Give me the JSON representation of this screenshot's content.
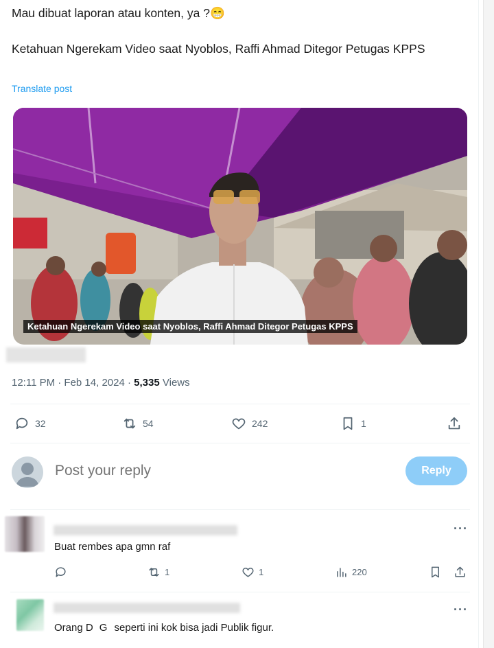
{
  "post": {
    "text_line1": "Mau dibuat laporan atau konten, ya ?😁",
    "text_line2": "Ketahuan Ngerekam Video saat Nyoblos, Raffi Ahmad Ditegor Petugas KPPS",
    "translate_label": "Translate post",
    "video_caption": "Ketahuan Ngerekam Video saat Nyoblos, Raffi Ahmad Ditegor Petugas KPPS",
    "timestamp": "12:11 PM · Feb 14, 2024",
    "separator": " · ",
    "views_count": "5,335",
    "views_label": "Views"
  },
  "actions": {
    "replies": "32",
    "reposts": "54",
    "likes": "242",
    "bookmarks": "1"
  },
  "reply_box": {
    "placeholder": "Post your reply",
    "button_label": "Reply"
  },
  "comments": [
    {
      "text": "Buat rembes apa gmn raf",
      "replies": "",
      "reposts": "1",
      "likes": "1",
      "views": "220",
      "more": "···"
    },
    {
      "text": "Orang D   G   seperti ini kok bisa jadi Publik figur.",
      "more": "···"
    }
  ],
  "colors": {
    "accent": "#1d9bf0",
    "reply_button": "#8ecdf8",
    "muted": "#536471"
  },
  "icons": [
    "reply-icon",
    "repost-icon",
    "like-icon",
    "bookmark-icon",
    "share-icon",
    "views-icon",
    "more-icon",
    "user-avatar-icon"
  ]
}
